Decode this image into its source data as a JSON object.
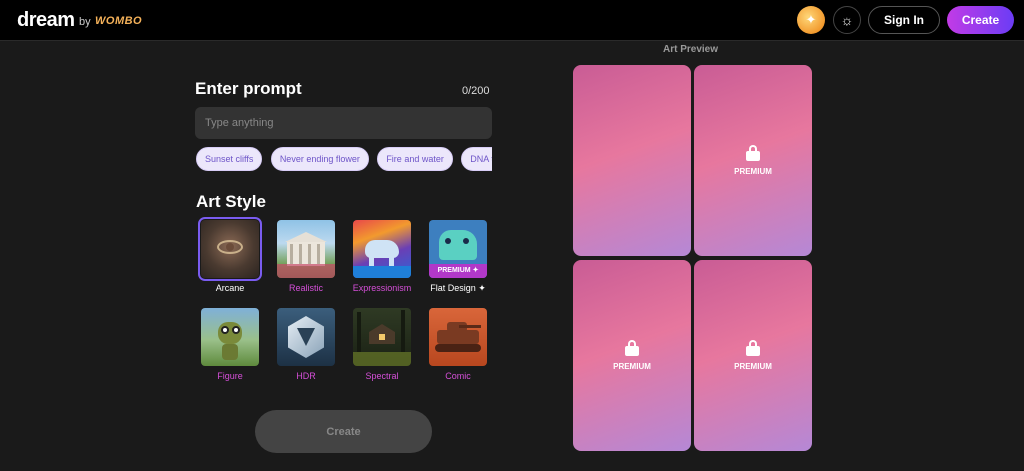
{
  "header": {
    "logo": "dream",
    "by": "by",
    "brand": "WOMBO",
    "signin_label": "Sign In",
    "create_label": "Create"
  },
  "prompt": {
    "title": "Enter prompt",
    "counter": "0/200",
    "placeholder": "Type anything",
    "suggestions": [
      "Sunset cliffs",
      "Never ending flower",
      "Fire and water",
      "DNA tornado"
    ]
  },
  "art_style": {
    "title": "Art Style",
    "styles": [
      {
        "label": "Arcane",
        "selected": true
      },
      {
        "label": "Realistic"
      },
      {
        "label": "Expressionism"
      },
      {
        "label": "Flat Design ✦",
        "premium": "PREMIUM ✦"
      },
      {
        "label": "Figure"
      },
      {
        "label": "HDR"
      },
      {
        "label": "Spectral"
      },
      {
        "label": "Comic"
      }
    ]
  },
  "create_button": "Create",
  "preview": {
    "title": "Art Preview",
    "cards": [
      {
        "label": ""
      },
      {
        "label": "PREMIUM"
      },
      {
        "label": "PREMIUM"
      },
      {
        "label": "PREMIUM"
      }
    ]
  }
}
